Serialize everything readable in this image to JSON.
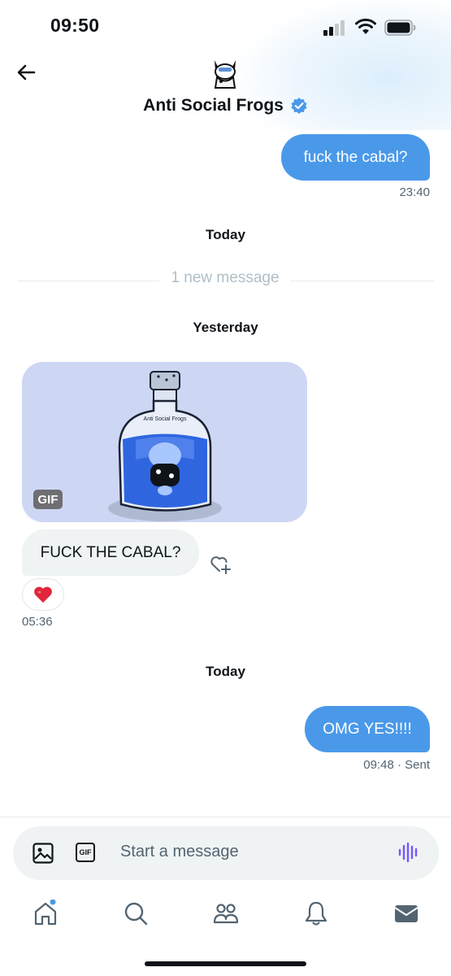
{
  "status_bar": {
    "time": "09:50"
  },
  "header": {
    "title": "Anti Social Frogs",
    "verified": true
  },
  "messages": {
    "sent_1": {
      "text": "fuck the cabal?",
      "time": "23:40"
    },
    "day_today_1": "Today",
    "new_message_label": "1 new message",
    "day_yesterday": "Yesterday",
    "gif": {
      "badge": "GIF",
      "bottle_label": "Anti Social Frogs"
    },
    "received_1": {
      "text": "FUCK THE CABAL?",
      "reaction": "❤️",
      "time": "05:36"
    },
    "day_today_2": "Today",
    "sent_2": {
      "text": "OMG YES!!!!",
      "time": "09:48",
      "status": "· Sent"
    }
  },
  "composer": {
    "placeholder": "Start a message",
    "gif_label": "GIF"
  },
  "tabs": [
    {
      "icon": "home-icon",
      "has_badge": true
    },
    {
      "icon": "search-icon"
    },
    {
      "icon": "communities-icon"
    },
    {
      "icon": "bell-icon"
    },
    {
      "icon": "mail-icon",
      "active": true
    }
  ],
  "colors": {
    "accent": "#4a99e9",
    "incoming_bubble": "#eff3f4",
    "muted": "#536471",
    "voice": "#7856ff"
  }
}
